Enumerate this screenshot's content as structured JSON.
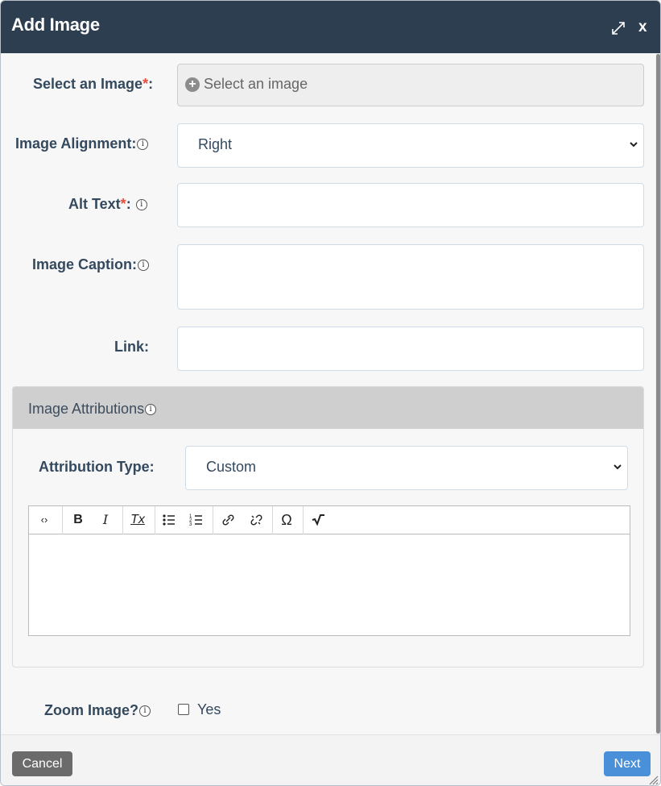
{
  "dialog": {
    "title": "Add Image",
    "close_label": "x"
  },
  "form": {
    "select_image": {
      "label": "Select an Image",
      "required_mark": "*",
      "suffix": ":",
      "placeholder": "Select an image"
    },
    "alignment": {
      "label": "Image Alignment:",
      "value": "Right"
    },
    "alt_text": {
      "label": "Alt Text",
      "required_mark": "*",
      "suffix": ":",
      "value": ""
    },
    "caption": {
      "label": "Image Caption:",
      "value": ""
    },
    "link": {
      "label": "Link:",
      "value": ""
    },
    "info_glyph": "i"
  },
  "attributions": {
    "title": "Image Attributions",
    "type_label": "Attribution Type:",
    "type_value": "Custom",
    "toolbar": {
      "source": "‹›",
      "bold": "B",
      "italic": "I",
      "remove_format": "Tx",
      "special_char": "Ω"
    }
  },
  "zoom": {
    "label": "Zoom Image?",
    "checkbox_label": "Yes",
    "checked": false
  },
  "footer": {
    "cancel_label": "Cancel",
    "next_label": "Next"
  },
  "colors": {
    "titlebar": "#2d3e50",
    "required": "#e74c3c",
    "next_button": "#4a90d9",
    "cancel_button": "#6b6b6b"
  }
}
